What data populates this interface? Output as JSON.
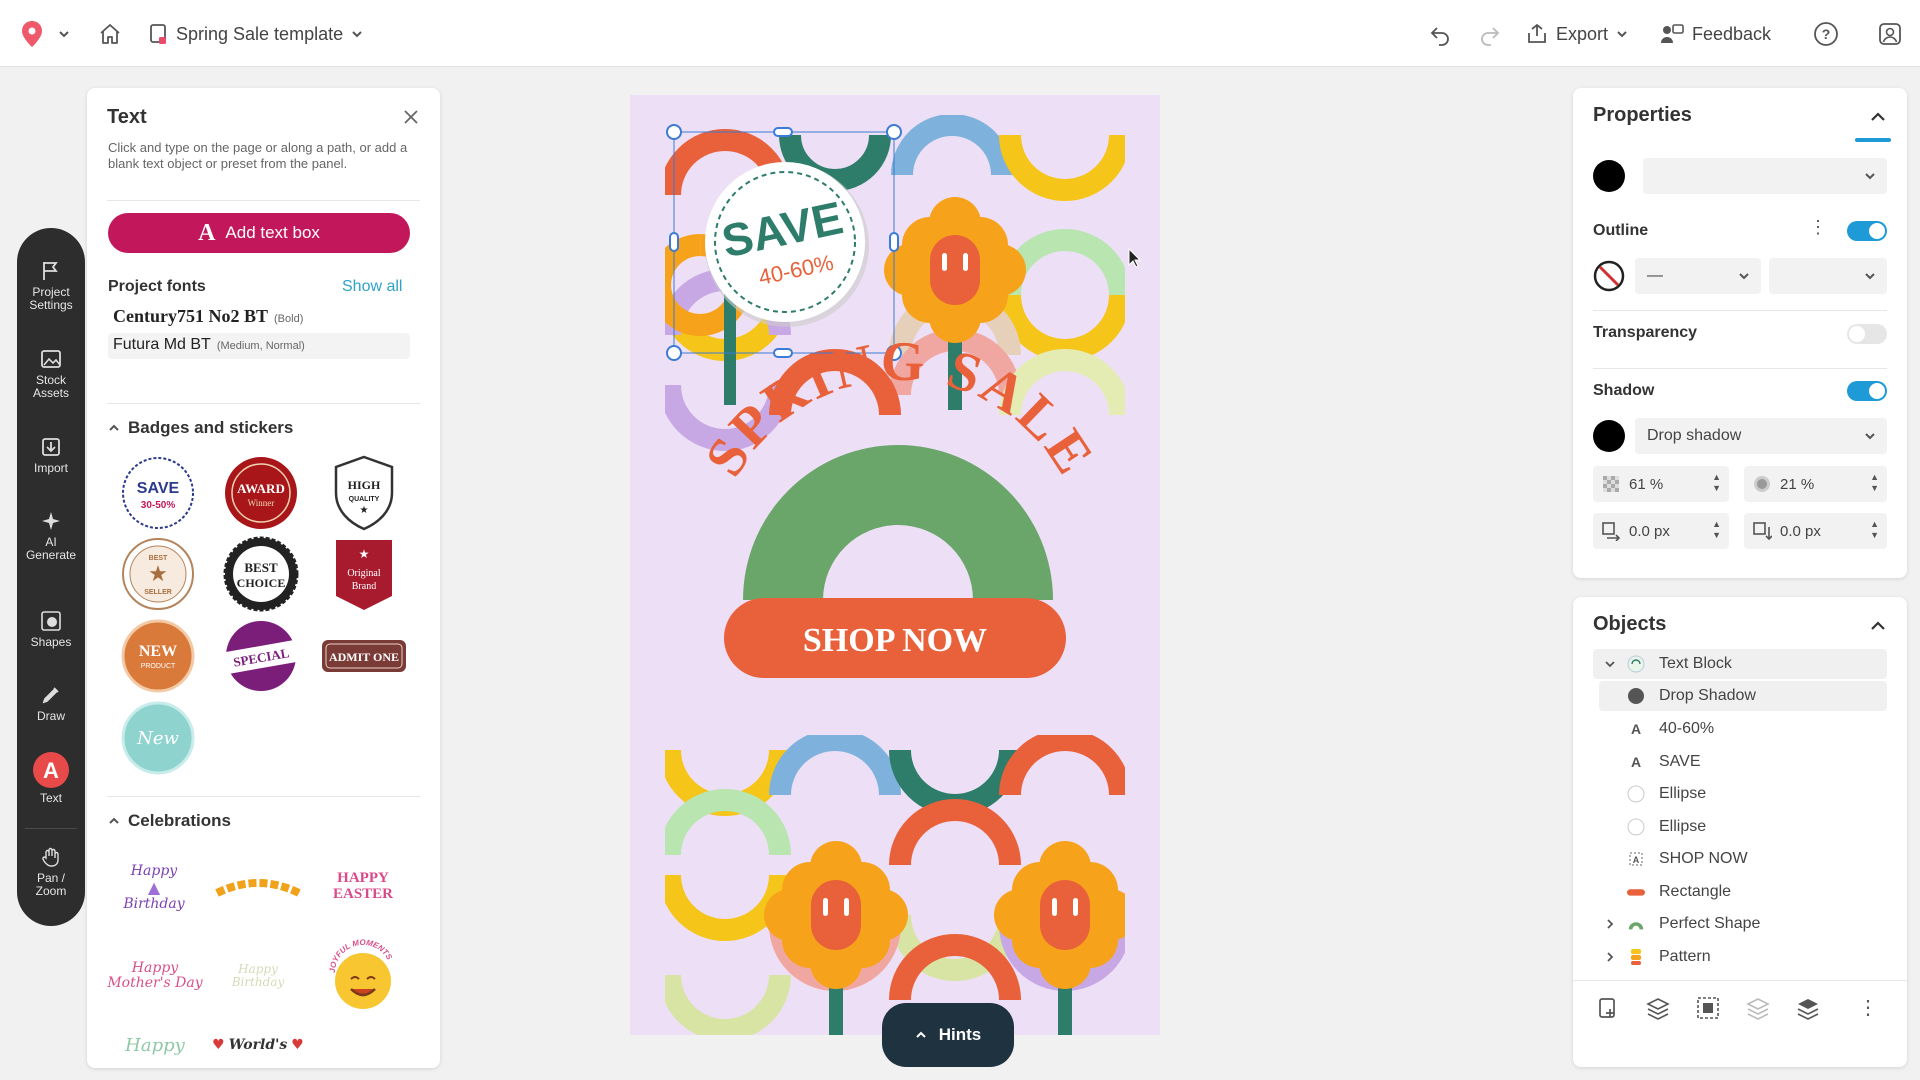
{
  "topbar": {
    "template_name": "Spring Sale template",
    "export_label": "Export",
    "feedback_label": "Feedback"
  },
  "tools": [
    {
      "label": "Project Settings",
      "line1": "Project",
      "line2": "Settings",
      "icon": "flag-icon"
    },
    {
      "label": "Stock Assets",
      "line1": "Stock",
      "line2": "Assets",
      "icon": "image-icon"
    },
    {
      "label": "Import",
      "line1": "Import",
      "line2": "",
      "icon": "import-icon"
    },
    {
      "label": "AI Generate",
      "line1": "AI",
      "line2": "Generate",
      "icon": "sparkle-icon"
    },
    {
      "label": "Shapes",
      "line1": "Shapes",
      "line2": "",
      "icon": "shapes-icon"
    },
    {
      "label": "Draw",
      "line1": "Draw",
      "line2": "",
      "icon": "pen-icon"
    },
    {
      "label": "Text",
      "line1": "Text",
      "line2": "",
      "icon": "text-icon"
    },
    {
      "label": "Pan / Zoom",
      "line1": "Pan /",
      "line2": "Zoom",
      "icon": "hand-icon"
    }
  ],
  "text_panel": {
    "title": "Text",
    "description": "Click and type on the page or along a path, or add a blank text object or preset from the panel.",
    "add_button": "Add text box",
    "project_fonts_title": "Project fonts",
    "show_all": "Show all",
    "fonts": [
      {
        "name": "Century751 No2 BT",
        "meta": "(Bold)"
      },
      {
        "name": "Futura Md BT",
        "meta": "(Medium, Normal)"
      }
    ],
    "badges_title": "Badges and stickers",
    "badges": [
      {
        "name": "save",
        "line1": "SAVE",
        "line2": "30-50%"
      },
      {
        "name": "award",
        "line1": "AWARD",
        "line2": "Winner"
      },
      {
        "name": "high-quality",
        "line1": "HIGH",
        "line2": "QUALITY"
      },
      {
        "name": "best-seller",
        "line1": "BEST",
        "line2": "SELLER"
      },
      {
        "name": "best-choice",
        "line1": "BEST",
        "line2": "CHOICE"
      },
      {
        "name": "original-brand",
        "line1": "Original",
        "line2": "Brand"
      },
      {
        "name": "new-product",
        "line1": "NEW",
        "line2": "PRODUCT"
      },
      {
        "name": "special",
        "line1": "SPECIAL",
        "line2": ""
      },
      {
        "name": "admit-one",
        "line1": "ADMIT ONE",
        "line2": ""
      },
      {
        "name": "new-script",
        "line1": "New",
        "line2": ""
      }
    ],
    "celebrations_title": "Celebrations",
    "celebrations": [
      {
        "name": "happy-birthday",
        "line1": "Happy",
        "line2": "Birthday"
      },
      {
        "name": "congrats",
        "line1": "",
        "line2": ""
      },
      {
        "name": "happy-easter",
        "line1": "HAPPY",
        "line2": "EASTER"
      },
      {
        "name": "happy-mothers-day",
        "line1": "Happy",
        "line2": "Mother's Day"
      },
      {
        "name": "happy-birthday-2",
        "line1": "Happy",
        "line2": "Birthday"
      },
      {
        "name": "joyful-moments",
        "line1": "JOYFUL MOMENTS",
        "line2": ""
      },
      {
        "name": "happy-3",
        "line1": "Happy",
        "line2": ""
      },
      {
        "name": "worlds",
        "line1": "World's",
        "line2": ""
      }
    ]
  },
  "canvas": {
    "save_text": "SAVE",
    "discount_text": "40-60%",
    "headline": "SPRING SALE",
    "cta": "SHOP NOW",
    "colors": {
      "background": "#eddff5",
      "orange": "#e8613a",
      "green": "#6aa66a",
      "teal": "#2e7d6b",
      "yellow": "#f6c519",
      "flower_orange": "#f7a21b"
    }
  },
  "hints": {
    "label": "Hints"
  },
  "properties": {
    "title": "Properties",
    "fill_color": "#000000",
    "outline_label": "Outline",
    "outline_enabled": true,
    "outline_style": "—",
    "transparency_label": "Transparency",
    "transparency_enabled": false,
    "shadow_label": "Shadow",
    "shadow_enabled": true,
    "shadow_type": "Drop shadow",
    "shadow_opacity": "61 %",
    "shadow_blur": "21 %",
    "shadow_x": "0.0 px",
    "shadow_y": "0.0 px",
    "accent": "#1e9ad6"
  },
  "objects": {
    "title": "Objects",
    "items": [
      {
        "label": "Text Block",
        "icon": "group-icon",
        "expand": "open"
      },
      {
        "label": "Drop Shadow",
        "icon": "shadow-dot-icon",
        "selected": true
      },
      {
        "label": "40-60%",
        "icon": "text-a-icon"
      },
      {
        "label": "SAVE",
        "icon": "text-a-icon"
      },
      {
        "label": "Ellipse",
        "icon": "ellipse-icon"
      },
      {
        "label": "Ellipse",
        "icon": "ellipse-icon"
      },
      {
        "label": "SHOP NOW",
        "icon": "text-group-icon"
      },
      {
        "label": "Rectangle",
        "icon": "rectangle-icon"
      },
      {
        "label": "Perfect Shape",
        "icon": "arch-icon",
        "expand": "closed"
      },
      {
        "label": "Pattern",
        "icon": "pattern-icon",
        "expand": "closed"
      }
    ]
  }
}
